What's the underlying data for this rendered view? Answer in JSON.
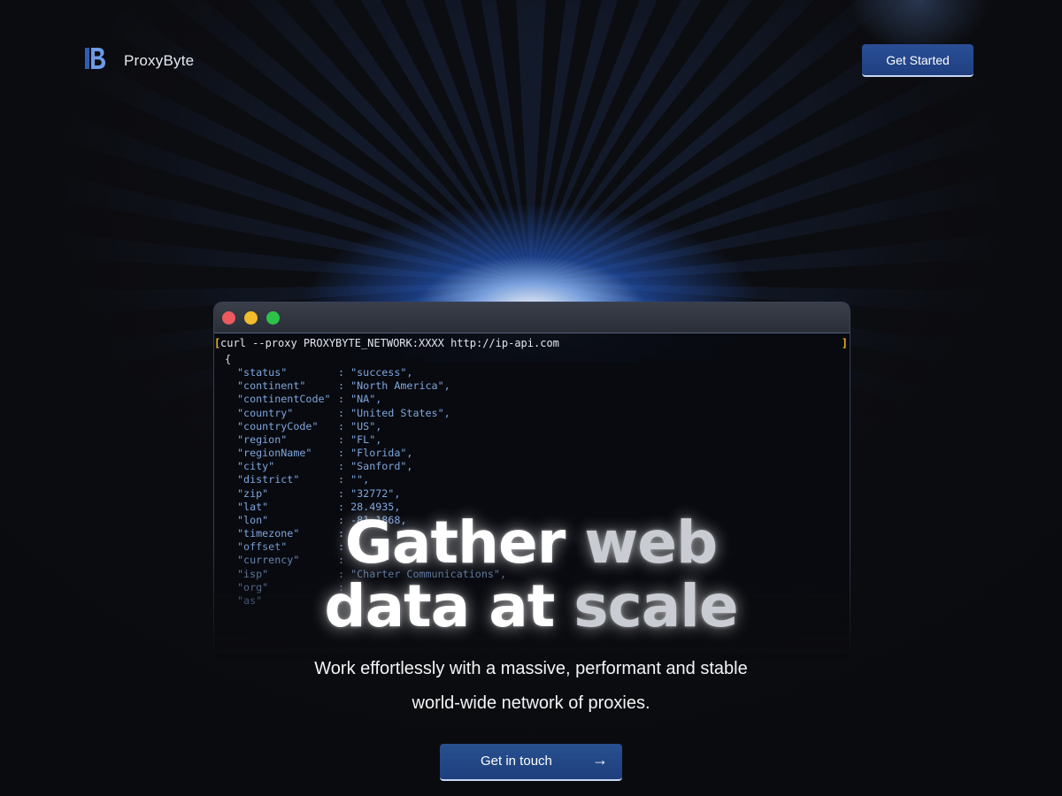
{
  "brand": {
    "name": "ProxyByte",
    "logo_icon": "proxybyte-logo-icon"
  },
  "header": {
    "cta_label": "Get Started"
  },
  "terminal": {
    "command": "curl --proxy PROXYBYTE_NETWORK:XXXX http://ip-api.com",
    "open_brace": "{",
    "rows": [
      {
        "key": "\"status\"",
        "value": "\"success\","
      },
      {
        "key": "\"continent\"",
        "value": "\"North America\","
      },
      {
        "key": "\"continentCode\"",
        "value": "\"NA\","
      },
      {
        "key": "\"country\"",
        "value": "\"United States\","
      },
      {
        "key": "\"countryCode\"",
        "value": "\"US\","
      },
      {
        "key": "\"region\"",
        "value": "\"FL\","
      },
      {
        "key": "\"regionName\"",
        "value": "\"Florida\","
      },
      {
        "key": "\"city\"",
        "value": "\"Sanford\","
      },
      {
        "key": "\"district\"",
        "value": "\"\","
      },
      {
        "key": "\"zip\"",
        "value": "\"32772\","
      },
      {
        "key": "\"lat\"",
        "value": "28.4935,"
      },
      {
        "key": "\"lon\"",
        "value": "-81.1868,"
      },
      {
        "key": "\"timezone\"",
        "value": ""
      },
      {
        "key": "\"offset\"",
        "value": ""
      },
      {
        "key": "\"currency\"",
        "value": ""
      },
      {
        "key": "\"isp\"",
        "value": "\"Charter Communications\","
      },
      {
        "key": "\"org\"",
        "value": ""
      },
      {
        "key": "\"as\"",
        "value": ""
      }
    ]
  },
  "hero": {
    "title_line1_a": "Gather",
    "title_line1_b": "web",
    "title_line2_a": "data at",
    "title_line2_b": "scale",
    "subtitle_line1": "Work effortlessly with a massive, performant and stable",
    "subtitle_line2": "world-wide network of proxies.",
    "cta_label": "Get in touch",
    "cta_icon": "arrow-right-icon",
    "cta_arrow": "→"
  },
  "colors": {
    "background": "#0c0d11",
    "button": "#24498b",
    "json_text": "#7fa6dc",
    "bracket": "#f0b32c"
  }
}
